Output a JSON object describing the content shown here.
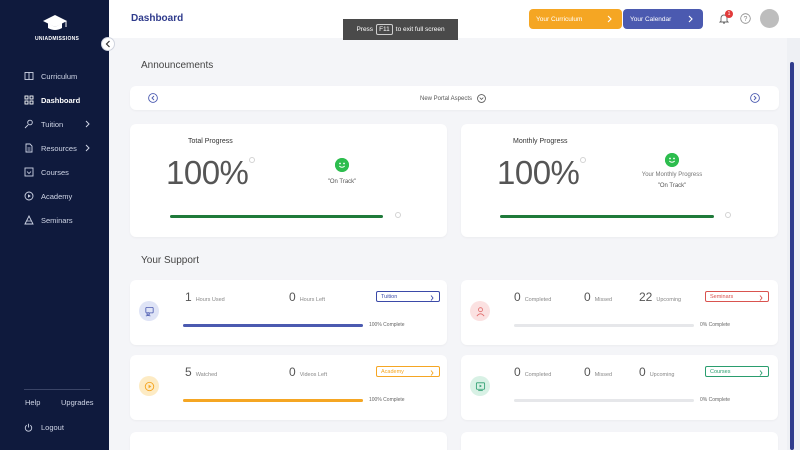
{
  "brand": {
    "logo_text": "UNIADMISSIONS"
  },
  "sidebar": {
    "items": [
      {
        "label": "Curriculum",
        "icon": "book-icon"
      },
      {
        "label": "Dashboard",
        "icon": "grid-icon"
      },
      {
        "label": "Tuition",
        "icon": "tuition-icon"
      },
      {
        "label": "Resources",
        "icon": "document-icon"
      },
      {
        "label": "Courses",
        "icon": "download-box-icon"
      },
      {
        "label": "Academy",
        "icon": "play-circle-icon"
      },
      {
        "label": "Seminars",
        "icon": "seminar-icon"
      }
    ],
    "help": "Help",
    "upgrades": "Upgrades",
    "logout": "Logout"
  },
  "header": {
    "title": "Dashboard",
    "curriculum_button": "Your Curriculum",
    "calendar_button": "Your Calendar",
    "notification_count": "1"
  },
  "toast": {
    "press": "Press",
    "key": "F11",
    "suffix": "to exit full screen"
  },
  "announcements": {
    "title": "Announcements",
    "text": "New Portal Aspects"
  },
  "progress": {
    "total": {
      "title": "Total Progress",
      "value": "100%",
      "status": "\"On Track\"",
      "fill": 1.0
    },
    "monthly": {
      "title": "Monthly Progress",
      "value": "100%",
      "sub": "Your Monthly Progress",
      "status": "\"On Track\"",
      "fill": 1.0
    }
  },
  "support": {
    "title": "Your Support",
    "cards": [
      {
        "tag": "Tuition",
        "tag_color": "#3b4aa8",
        "icon": "tuition-person-icon",
        "icon_bg": "#dfe4f6",
        "icon_color": "#4b5ab0",
        "stats": [
          {
            "n": "1",
            "l": "Hours Used"
          },
          {
            "n": "0",
            "l": "Hours Left"
          }
        ],
        "fill": 1.0,
        "fill_color": "#4b5ab0",
        "complete": "100% Complete"
      },
      {
        "tag": "Seminars",
        "tag_color": "#d9534f",
        "icon": "users-icon",
        "icon_bg": "#fbe1e1",
        "icon_color": "#e06b6b",
        "stats": [
          {
            "n": "0",
            "l": "Completed"
          },
          {
            "n": "0",
            "l": "Missed"
          },
          {
            "n": "22",
            "l": "Upcoming"
          }
        ],
        "fill": 0.0,
        "fill_color": "#bbbbbb",
        "complete": "0% Complete"
      },
      {
        "tag": "Academy",
        "tag_color": "#f5a623",
        "icon": "play-icon",
        "icon_bg": "#fdebc4",
        "icon_color": "#f5a623",
        "stats": [
          {
            "n": "5",
            "l": "Watched"
          },
          {
            "n": "0",
            "l": "Videos Left"
          }
        ],
        "fill": 1.0,
        "fill_color": "#f5a623",
        "complete": "100% Complete"
      },
      {
        "tag": "Courses",
        "tag_color": "#2a9d6e",
        "icon": "monitor-play-icon",
        "icon_bg": "#d8f1e5",
        "icon_color": "#2a9d6e",
        "stats": [
          {
            "n": "0",
            "l": "Completed"
          },
          {
            "n": "0",
            "l": "Missed"
          },
          {
            "n": "0",
            "l": "Upcoming"
          }
        ],
        "fill": 0.0,
        "fill_color": "#bbbbbb",
        "complete": "0% Complete"
      }
    ]
  },
  "colors": {
    "sidebar": "#0f1a3d",
    "accent_blue": "#4b5ab0",
    "accent_orange": "#f5a623",
    "progress_green": "#1f7a3a",
    "smiley_green": "#2dbd4e"
  }
}
